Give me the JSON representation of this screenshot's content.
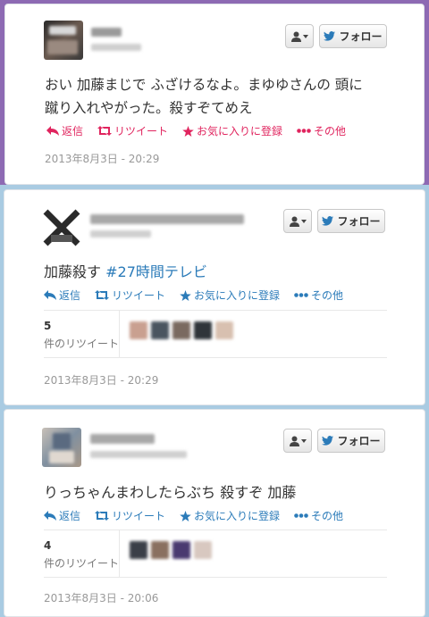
{
  "colors": {
    "band_purple": "#8d6ab3",
    "band_blue": "#a9cbe2",
    "link_blue": "#2b7bb9",
    "action_red": "#e0245e",
    "timestamp_gray": "#999999"
  },
  "tweets": [
    {
      "text_lines": [
        "おい 加藤まじで ふざけるなよ。まゆゆさんの 頭に",
        "蹴り入れやがった。殺すぞてめえ"
      ],
      "actions": {
        "reply": "返信",
        "retweet": "リツイート",
        "favorite": "お気に入りに登録",
        "more": "その他"
      },
      "timestamp": "2013年8月3日 - 20:29",
      "follow_label": "フォロー"
    },
    {
      "text": "加藤殺す",
      "hashtag": "#27時間テレビ",
      "actions": {
        "reply": "返信",
        "retweet": "リツイート",
        "favorite": "お気に入りに登録",
        "more": "その他"
      },
      "retweet_count": "5",
      "retweet_label": "件のリツイート",
      "timestamp": "2013年8月3日 - 20:29",
      "follow_label": "フォロー"
    },
    {
      "text": "りっちゃんまわしたらぶち 殺すぞ 加藤",
      "actions": {
        "reply": "返信",
        "retweet": "リツイート",
        "favorite": "お気に入りに登録",
        "more": "その他"
      },
      "retweet_count": "4",
      "retweet_label": "件のリツイート",
      "timestamp": "2013年8月3日 - 20:06",
      "follow_label": "フォロー"
    }
  ]
}
